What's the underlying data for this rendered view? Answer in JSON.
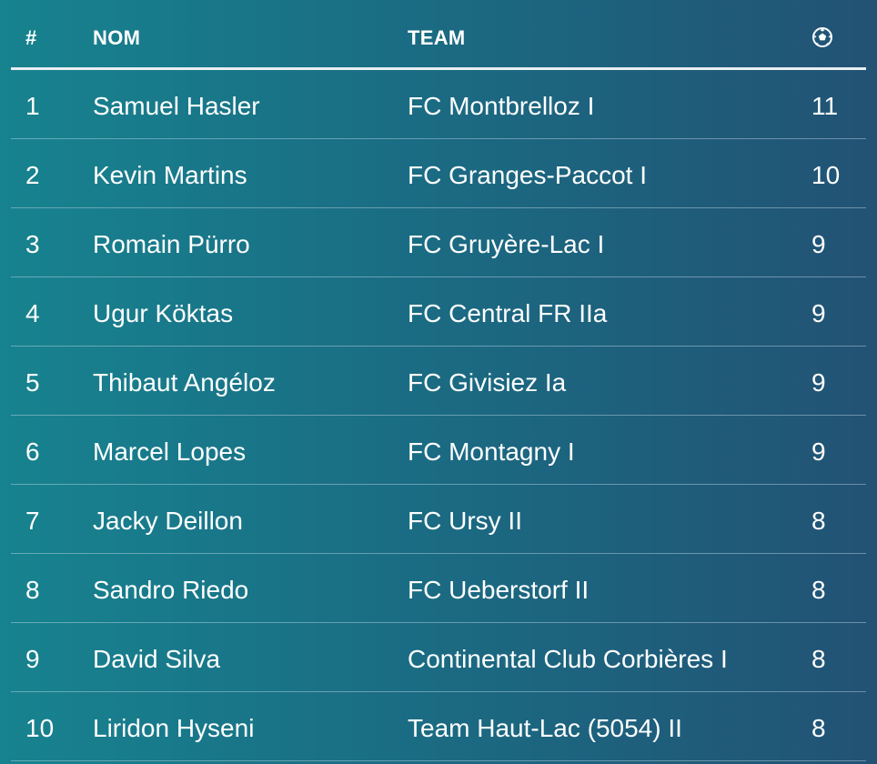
{
  "header": {
    "rank": "#",
    "name": "NOM",
    "team": "TEAM",
    "goals_icon": "soccer-ball-icon"
  },
  "rows": [
    {
      "rank": "1",
      "name": "Samuel Hasler",
      "team": "FC Montbrelloz I",
      "goals": "11"
    },
    {
      "rank": "2",
      "name": "Kevin Martins",
      "team": "FC Granges-Paccot I",
      "goals": "10"
    },
    {
      "rank": "3",
      "name": "Romain Pürro",
      "team": "FC Gruyère-Lac I",
      "goals": "9"
    },
    {
      "rank": "4",
      "name": "Ugur Köktas",
      "team": "FC Central FR IIa",
      "goals": "9"
    },
    {
      "rank": "5",
      "name": "Thibaut Angéloz",
      "team": "FC Givisiez Ia",
      "goals": "9"
    },
    {
      "rank": "6",
      "name": "Marcel Lopes",
      "team": "FC Montagny I",
      "goals": "9"
    },
    {
      "rank": "7",
      "name": "Jacky Deillon",
      "team": "FC Ursy II",
      "goals": "8"
    },
    {
      "rank": "8",
      "name": "Sandro Riedo",
      "team": "FC Ueberstorf II",
      "goals": "8"
    },
    {
      "rank": "9",
      "name": "David Silva",
      "team": "Continental Club Corbières I",
      "goals": "8"
    },
    {
      "rank": "10",
      "name": "Liridon Hyseni",
      "team": "Team Haut-Lac (5054) II",
      "goals": "8"
    }
  ],
  "colors": {
    "gradient_start": "#17838f",
    "gradient_end": "#225274",
    "text": "#ffffff",
    "header_rule": "#e9eef2"
  }
}
